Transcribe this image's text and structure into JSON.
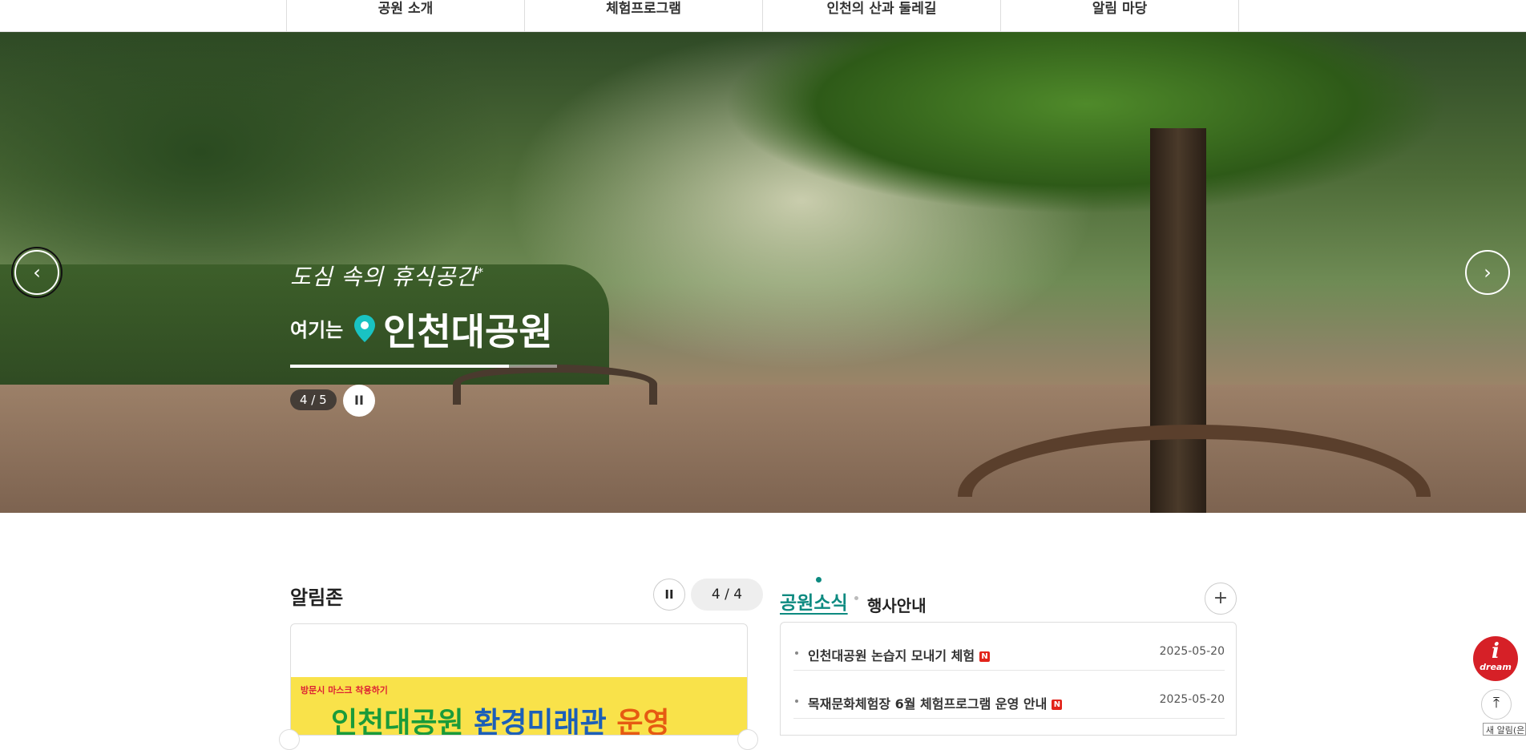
{
  "top_nav": {
    "items": [
      "공원 소개",
      "체험프로그램",
      "인천의 산과 둘레길",
      "알림 마당"
    ]
  },
  "hero": {
    "subtitle": "도심 속의 휴식공간",
    "subtitle_mark": "*",
    "lead": "여기는",
    "title": "인천대공원",
    "slide_counter": "4 / 5",
    "progress": 0.82,
    "pause_symbol": "II",
    "prev_symbol": "‹",
    "next_symbol": "›"
  },
  "alrim": {
    "title": "알림존",
    "pause_symbol": "II",
    "counter": "4 / 4",
    "banner": {
      "small_text": "방문시 마스크 착용하기",
      "head_1": "인천대공원",
      "head_2": "환경미래관",
      "head_3": "운영"
    }
  },
  "news": {
    "tab_active": "공원소식",
    "tab_other": "행사안내",
    "more_symbol": "+",
    "items": [
      {
        "title": "인천대공원 논습지 모내기 체험",
        "badge": "N",
        "date": "2025-05-20"
      },
      {
        "title": "목재문화체험장 6월 체험프로그램 운영 안내",
        "badge": "N",
        "date": "2025-05-20"
      }
    ]
  },
  "floating": {
    "dream_letter": "i",
    "dream_label": "dream",
    "top_symbol": "⤒",
    "notification": "새 알림(은"
  },
  "colors": {
    "accent_teal": "#0d8a80",
    "badge_red": "#e2231a",
    "dream_red": "#d62027"
  }
}
